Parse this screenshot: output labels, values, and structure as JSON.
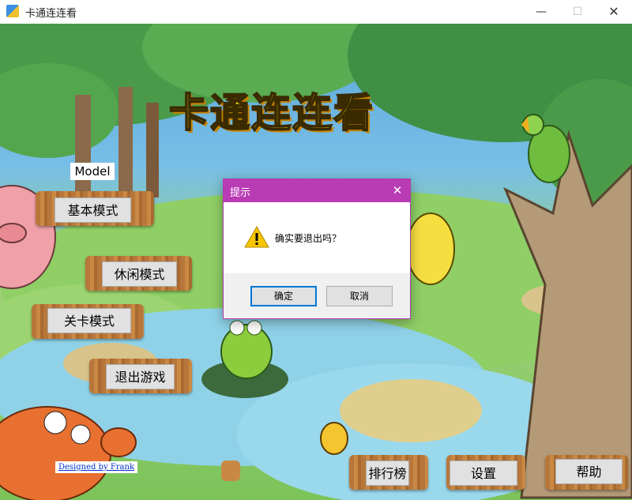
{
  "window": {
    "title": "卡通连连看",
    "minimize": "—",
    "maximize": "☐",
    "close": "✕"
  },
  "game": {
    "title": "卡通连连看",
    "model_label": "Model",
    "mode_buttons": [
      "基本模式",
      "休闲模式",
      "关卡模式",
      "退出游戏"
    ],
    "bottom_buttons": [
      "排行榜",
      "设置",
      "帮助"
    ],
    "credit": "Designed by Frank"
  },
  "dialog": {
    "title": "提示",
    "close": "✕",
    "message": "确实要退出吗？",
    "ok": "确定",
    "cancel": "取消"
  },
  "colors": {
    "dialog_title": "#b93cb5",
    "title_text": "#ffe81a"
  }
}
